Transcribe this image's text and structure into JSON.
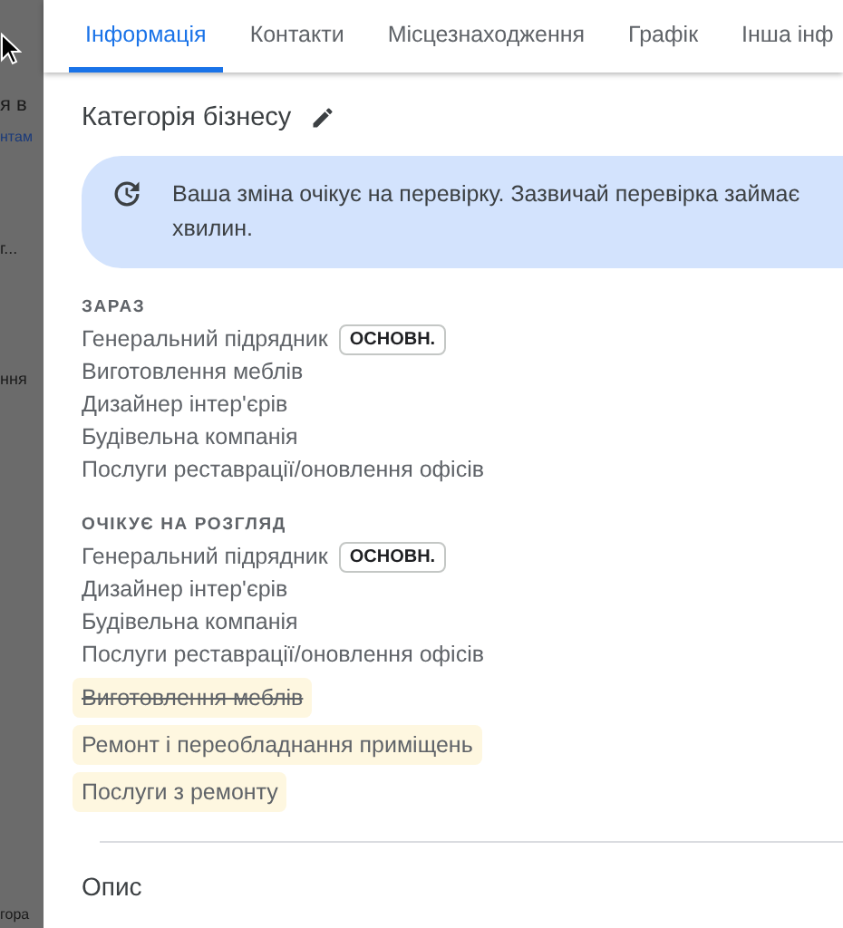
{
  "background_page": {
    "texts": [
      "я в",
      "нтам",
      "г...",
      "ння",
      "гора"
    ]
  },
  "tabs": [
    {
      "label": "Інформація",
      "selected": true
    },
    {
      "label": "Контакти",
      "selected": false
    },
    {
      "label": "Місцезнаходження",
      "selected": false
    },
    {
      "label": "Графік",
      "selected": false
    },
    {
      "label": "Інша інф",
      "selected": false
    }
  ],
  "section": {
    "title": "Категорія бізнесу",
    "notice": "Ваша зміна очікує на перевірку. Зазвичай перевірка займає хвилин.",
    "groups": [
      {
        "heading": "ЗАРАЗ",
        "items": [
          {
            "label": "Генеральний підрядник",
            "badge": "ОСНОВН.",
            "highlighted": false,
            "struck": false
          },
          {
            "label": "Виготовлення меблів",
            "highlighted": false,
            "struck": false
          },
          {
            "label": "Дизайнер інтер'єрів",
            "highlighted": false,
            "struck": false
          },
          {
            "label": "Будівельна компанія",
            "highlighted": false,
            "struck": false
          },
          {
            "label": "Послуги реставрації/оновлення офісів",
            "highlighted": false,
            "struck": false
          }
        ]
      },
      {
        "heading": "ОЧІКУЄ НА РОЗГЛЯД",
        "items": [
          {
            "label": "Генеральний підрядник",
            "badge": "ОСНОВН.",
            "highlighted": false,
            "struck": false
          },
          {
            "label": "Дизайнер інтер'єрів",
            "highlighted": false,
            "struck": false
          },
          {
            "label": "Будівельна компанія",
            "highlighted": false,
            "struck": false
          },
          {
            "label": "Послуги реставрації/оновлення офісів",
            "highlighted": false,
            "struck": false
          },
          {
            "label": "Виготовлення меблів",
            "highlighted": true,
            "struck": true
          },
          {
            "label": "Ремонт і переобладнання приміщень",
            "highlighted": true,
            "struck": false
          },
          {
            "label": "Послуги з ремонту",
            "highlighted": true,
            "struck": false
          }
        ]
      }
    ]
  },
  "next_section": {
    "title": "Опис"
  }
}
